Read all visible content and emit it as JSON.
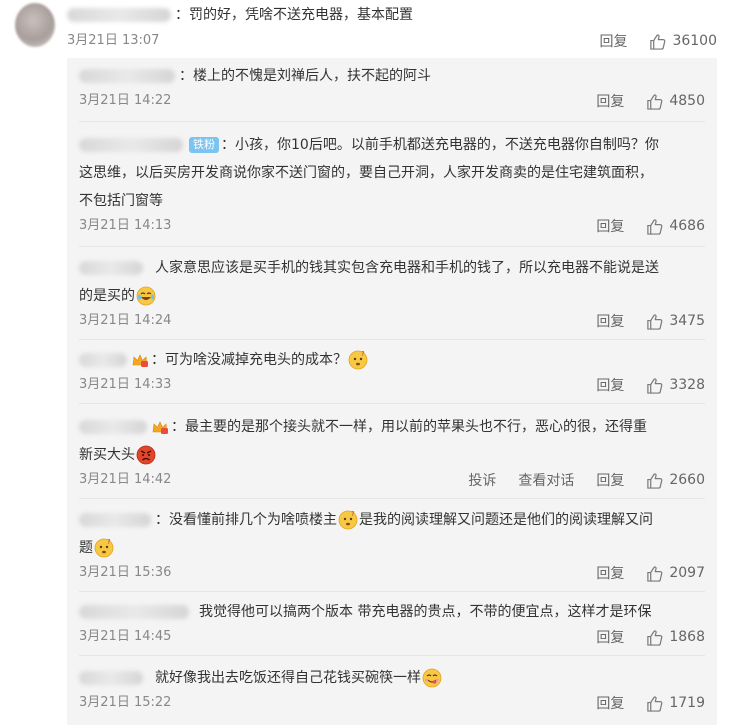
{
  "main_comment": {
    "text": "：罚的好，凭啥不送充电器，基本配置",
    "time": "3月21日 13:07",
    "reply_label": "回复",
    "likes": "36100"
  },
  "replies": [
    {
      "lines": [
        "：楼上的不愧是刘禅后人，扶不起的阿斗"
      ],
      "time": "3月21日 14:22",
      "reply_label": "回复",
      "likes": "4850"
    },
    {
      "badge": "铁粉",
      "lines": [
        "：小孩，你10后吧。以前手机都送充电器的，不送充电器你自制吗？你",
        "这思维，以后买房开发商说你家不送门窗的，要自己开洞，人家开发商卖的是住宅建筑面积，",
        "不包括门窗等"
      ],
      "time": "3月21日 14:13",
      "reply_label": "回复",
      "likes": "4686"
    },
    {
      "lines": [
        "人家意思应该是买手机的钱其实包含充电器和手机的钱了，所以充电器不能说是送",
        "的是买的"
      ],
      "time": "3月21日 14:24",
      "reply_label": "回复",
      "likes": "3475"
    },
    {
      "lines": [
        "：可为啥没减掉充电头的成本？"
      ],
      "time": "3月21日 14:33",
      "reply_label": "回复",
      "likes": "3328"
    },
    {
      "lines": [
        "：最主要的是那个接头就不一样，用以前的苹果头也不行，恶心的很，还得重",
        "新买大头"
      ],
      "time": "3月21日 14:42",
      "report_label": "投诉",
      "conversation_label": "查看对话",
      "reply_label": "回复",
      "likes": "2660"
    },
    {
      "lines": [
        "：没看懂前排几个为啥喷楼主",
        "是我的阅读理解又问题还是他们的阅读理解又问",
        "题"
      ],
      "time": "3月21日 15:36",
      "reply_label": "回复",
      "likes": "2097"
    },
    {
      "lines": [
        "我觉得他可以搞两个版本 带充电器的贵点，不带的便宜点，这样才是环保"
      ],
      "time": "3月21日 14:45",
      "reply_label": "回复",
      "likes": "1868"
    },
    {
      "lines": [
        "就好像我出去吃饭还得自己花钱买碗筷一样"
      ],
      "time": "3月21日 15:22",
      "reply_label": "回复",
      "likes": "1719"
    }
  ],
  "colors": {
    "meta": "#888888",
    "panel": "#f4f4f4",
    "badge": "#7cc4f0"
  },
  "icons": [
    "thumbs-up-icon",
    "tongue-smile-emoji",
    "laugh-cry-emoji",
    "doubt-emoji",
    "angry-emoji",
    "yummy-emoji",
    "vip-crown-icon"
  ]
}
